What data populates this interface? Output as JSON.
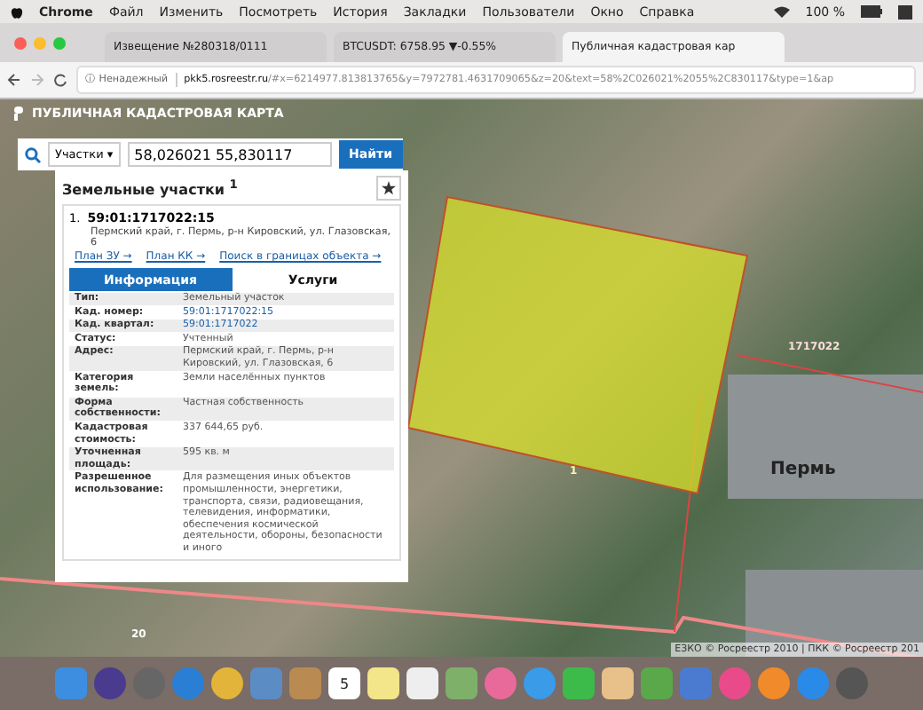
{
  "menubar": {
    "app": "Chrome",
    "items": [
      "Файл",
      "Изменить",
      "Посмотреть",
      "История",
      "Закладки",
      "Пользователи",
      "Окно",
      "Справка"
    ],
    "battery": "100 %"
  },
  "tabs": [
    {
      "title": "Извещение №280318/0111",
      "selected": false
    },
    {
      "title": "BTCUSDT: 6758.95 ▼-0.55%",
      "selected": false
    },
    {
      "title": "Публичная кадастровая кар",
      "selected": true
    }
  ],
  "address": {
    "info_glyph": "ⓘ",
    "security": "Ненадежный",
    "host": "pkk5.rosreestr.ru",
    "path": "/#x=6214977.813813765&y=7972781.4631709065&z=20&text=58%2C026021%2055%2C830117&type=1&ap"
  },
  "map": {
    "title": "ПУБЛИЧНАЯ КАДАСТРОВАЯ КАРТА",
    "search": {
      "filter": "Участки",
      "caret": "▾",
      "value": "58,026021 55,830117",
      "button": "Найти"
    },
    "panel": {
      "heading": "Земельные участки",
      "count": "1",
      "result": {
        "index": "1.",
        "number": "59:01:1717022:15",
        "address": "Пермский край, г. Пермь, р-н Кировский, ул. Глазовская, 6",
        "links": [
          "План ЗУ →",
          "План КК →",
          "Поиск в границах объекта →"
        ],
        "tabs": [
          {
            "label": "Информация",
            "selected": true
          },
          {
            "label": "Услуги",
            "selected": false
          }
        ],
        "rows": [
          {
            "label": "Тип:",
            "value": "Земельный участок",
            "link": false
          },
          {
            "label": "Кад. номер:",
            "value": "59:01:1717022:15",
            "link": true
          },
          {
            "label": "Кад. квартал:",
            "value": "59:01:1717022",
            "link": true
          },
          {
            "label": "Статус:",
            "value": "Учтенный",
            "link": false
          },
          {
            "label": "Адрес:",
            "value": "Пермский край, г. Пермь, р-н Кировский, ул. Глазовская, 6",
            "link": false
          },
          {
            "label": "Категория земель:",
            "value": "Земли населённых пунктов",
            "link": false
          },
          {
            "label": "Форма собственности:",
            "value": "Частная собственность",
            "link": false
          },
          {
            "label": "Кадастровая стоимость:",
            "value": "337 644,65 руб.",
            "link": false
          },
          {
            "label": "Уточненная площадь:",
            "value": "595 кв. м",
            "link": false
          },
          {
            "label": "Разрешенное использование:",
            "value": "Для размещения иных объектов промышленности, энергетики, транспорта, связи, радиовещания, телевидения, информатики, обеспечения космической деятельности, обороны, безопасности и иного",
            "link": false
          }
        ]
      }
    },
    "quarter_label": "1717022",
    "parcel_label": "1",
    "place": "Пермь",
    "corner_label": "20",
    "attribution": "ЕЗКО © Росреестр 2010 | ПКК © Росреестр 201"
  },
  "dock": {
    "calendar_day": "5"
  }
}
